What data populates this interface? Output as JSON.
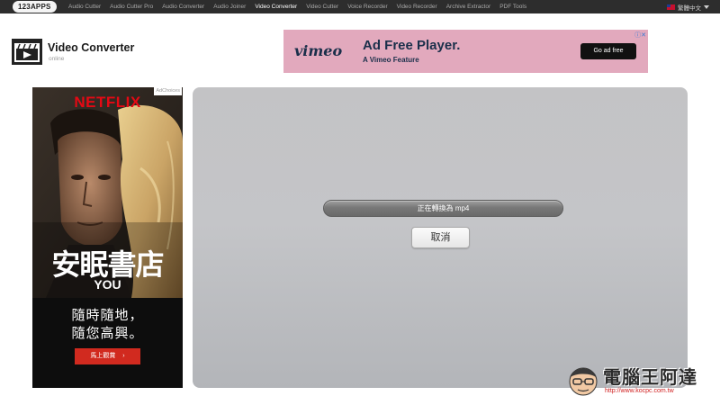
{
  "topbar": {
    "logo": "123APPS",
    "nav": [
      {
        "label": "Audio Cutter"
      },
      {
        "label": "Audio Cutter Pro"
      },
      {
        "label": "Audio Converter"
      },
      {
        "label": "Audio Joiner"
      },
      {
        "label": "Video Converter",
        "active": true
      },
      {
        "label": "Video Cutter"
      },
      {
        "label": "Voice Recorder"
      },
      {
        "label": "Video Recorder"
      },
      {
        "label": "Archive Extractor"
      },
      {
        "label": "PDF Tools"
      }
    ],
    "language": "繁體中文",
    "bg_color": "#2d2d2d"
  },
  "header": {
    "title": "Video Converter",
    "subtitle": "online",
    "icon": "film-clapper-icon"
  },
  "ad_top": {
    "brand": "vimeo",
    "headline": "Ad Free Player.",
    "subline": "A Vimeo Feature",
    "button": "Go ad free",
    "adchoices": "ⓘ✕",
    "bg_color": "#e2a9bd"
  },
  "ad_side": {
    "brand": "NETFLIX",
    "adchoices": "AdChoices",
    "title": "安眠書店",
    "subtitle": "YOU",
    "slogan_line1": "隨時隨地，",
    "slogan_line2": "隨您高興。",
    "button": "馬上觀賞",
    "button_arrow": "›",
    "brand_color": "#e50914"
  },
  "converter": {
    "status": "正在轉換為 mp4",
    "progress": 0,
    "cancel_label": "取消"
  },
  "watermark": {
    "title": "電腦王阿達",
    "url": "http://www.kocpc.com.tw"
  }
}
